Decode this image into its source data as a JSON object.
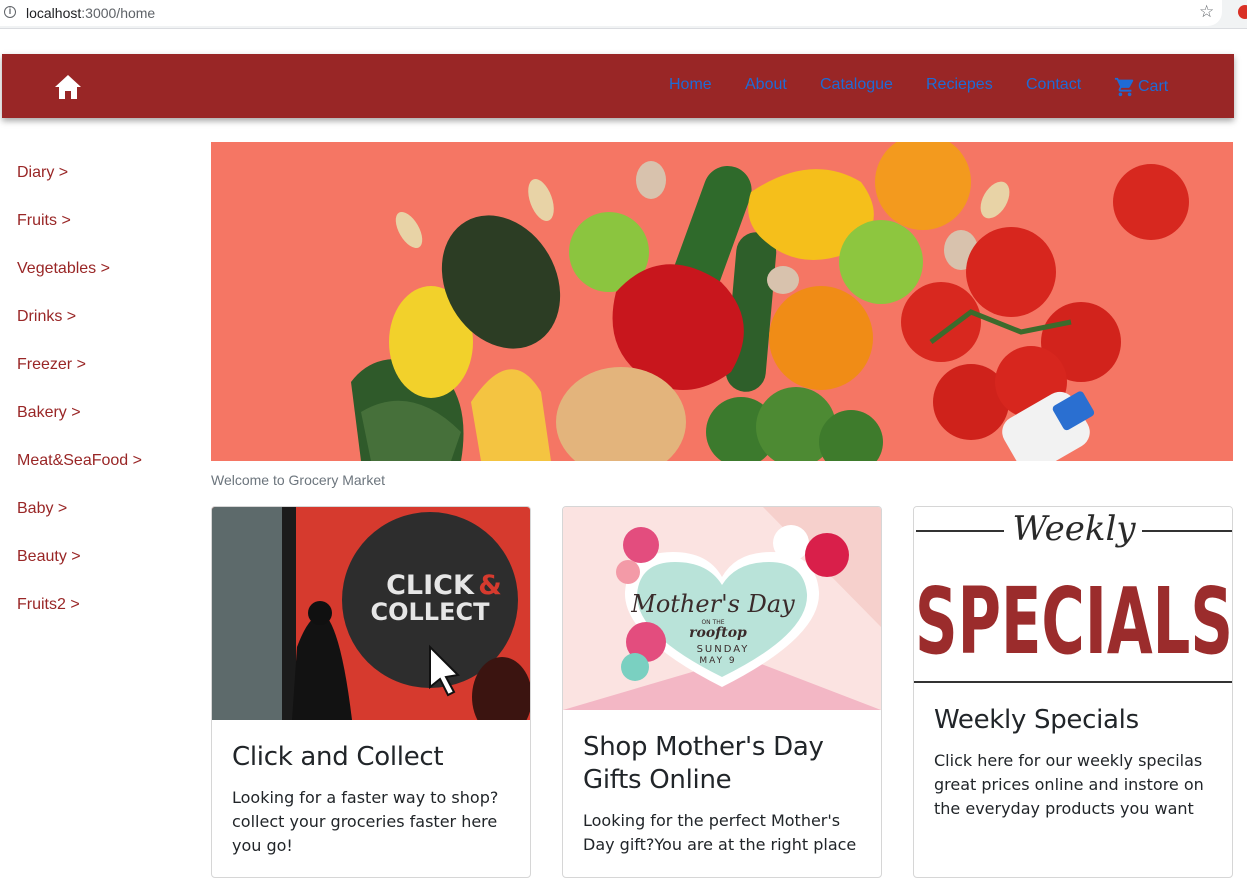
{
  "browser": {
    "url_host": "localhost",
    "url_rest": ":3000/home"
  },
  "navbar": {
    "links": [
      "Home",
      "About",
      "Catalogue",
      "Reciepes",
      "Contact"
    ],
    "cart_label": "Cart",
    "background": "#992626",
    "link_color": "#1e6bd6"
  },
  "sidebar": {
    "items": [
      "Diary >",
      "Fruits >",
      "Vegetables >",
      "Drinks >",
      "Freezer >",
      "Bakery >",
      "Meat&SeaFood >",
      "Baby >",
      "Beauty >",
      "Fruits2 >"
    ],
    "color": "#992626"
  },
  "hero": {
    "caption": "Welcome to Grocery Market"
  },
  "cards": [
    {
      "title": "Click and Collect",
      "text": "Looking for a faster way to shop? collect your groceries faster here you go!",
      "image_text": [
        "CLICK",
        "&",
        "COLLECT"
      ]
    },
    {
      "title": "Shop Mother's Day Gifts Online",
      "text": "Looking for the perfect Mother's Day gift?You are at the right place",
      "image_text": [
        "Mother's Day",
        "ON THE",
        "rooftop",
        "SUNDAY",
        "MAY 9"
      ]
    },
    {
      "title": "Weekly Specials",
      "text": "Click here for our weekly specilas great prices online and instore on the everyday products you want",
      "image_text": [
        "Weekly",
        "SPECIALS"
      ]
    }
  ]
}
